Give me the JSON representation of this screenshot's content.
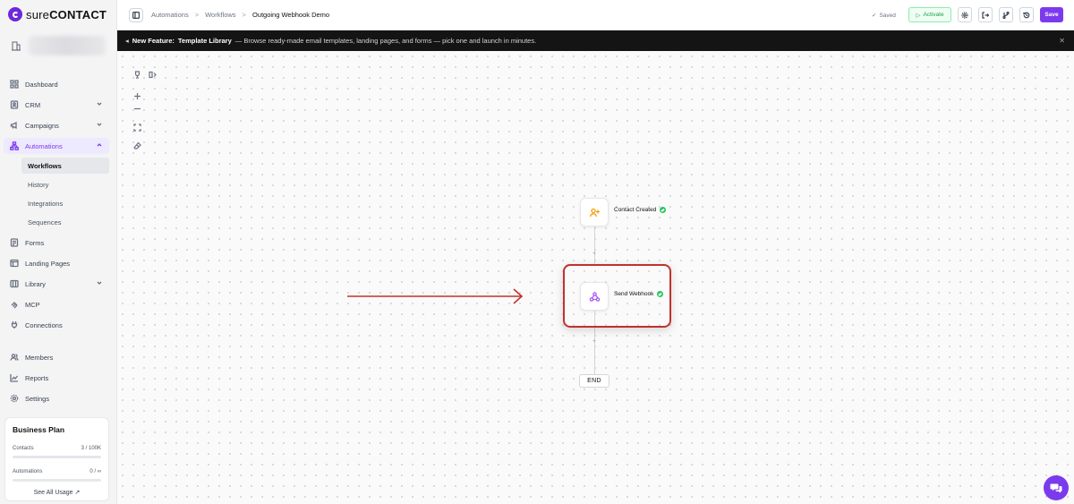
{
  "brand": {
    "name_light": "sure",
    "name_bold": "CONTACT",
    "accent": "#7c3aed"
  },
  "nav": {
    "dashboard": "Dashboard",
    "crm": "CRM",
    "campaigns": "Campaigns",
    "automations": "Automations",
    "workflows": "Workflows",
    "history": "History",
    "integrations": "Integrations",
    "sequences": "Sequences",
    "forms": "Forms",
    "landing_pages": "Landing Pages",
    "library": "Library",
    "mcp": "MCP",
    "connections": "Connections",
    "members": "Members",
    "reports": "Reports",
    "settings": "Settings"
  },
  "plan": {
    "title": "Business Plan",
    "contacts_label": "Contacts",
    "contacts_value": "3 / 100K",
    "automations_label": "Automations",
    "automations_value": "0 / ∞",
    "see_all": "See All Usage ↗"
  },
  "breadcrumb": {
    "first": "Automations",
    "second": "Workflows",
    "current": "Outgoing Webhook Demo"
  },
  "toolbar": {
    "saved": "Saved",
    "activate": "Activate",
    "save": "Save"
  },
  "banner": {
    "prefix": "New Feature:",
    "title": "Template Library",
    "text": "— Browse ready-made email templates, landing pages, and forms — pick one and launch in minutes."
  },
  "workflow": {
    "trigger_label": "Contact Created",
    "action_label": "Send Webhook",
    "end_label": "END",
    "trigger_color": "#f59e0b",
    "action_color": "#a855f7",
    "highlight_color": "#c0322f"
  }
}
